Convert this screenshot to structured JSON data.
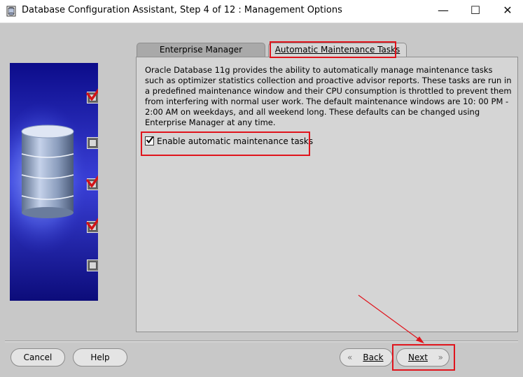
{
  "window": {
    "title": "Database Configuration Assistant, Step 4 of 12 : Management Options",
    "minimize_glyph": "—",
    "maximize_glyph": "☐",
    "close_glyph": "✕"
  },
  "steps": {
    "states": [
      "checked",
      "unchecked",
      "checked",
      "checked",
      "unchecked"
    ]
  },
  "tabs": [
    {
      "label": "Enterprise Manager",
      "active": false
    },
    {
      "label": "Automatic Maintenance Tasks",
      "active": true
    }
  ],
  "content": {
    "description": "Oracle Database 11g provides the ability to automatically manage maintenance tasks such as optimizer statistics collection and proactive advisor reports. These tasks are run in a predefined maintenance window and their CPU consumption is throttled to prevent them from interfering with normal user work. The default maintenance windows are 10: 00 PM - 2:00 AM on weekdays, and all weekend long. These defaults can be changed using Enterprise Manager at any time.",
    "checkbox": {
      "label": "Enable automatic maintenance tasks",
      "checked": true
    }
  },
  "buttons": {
    "cancel": "Cancel",
    "help": "Help",
    "back": "Back",
    "next": "Next"
  },
  "colors": {
    "highlight": "#e0141c",
    "panel_blue": "#1a1a9a"
  }
}
